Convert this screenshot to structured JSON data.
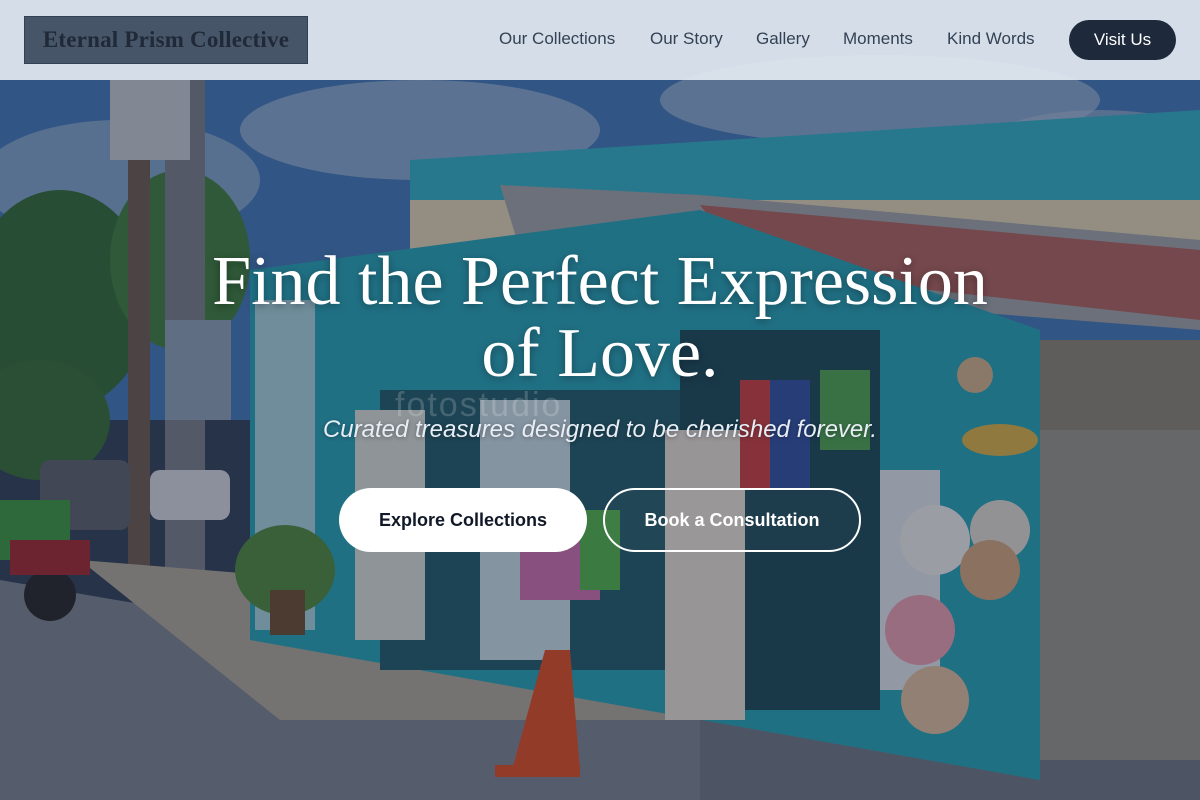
{
  "header": {
    "logo_text": "Eternal Prism Collective",
    "nav": [
      {
        "label": "Our Collections"
      },
      {
        "label": "Our Story"
      },
      {
        "label": "Gallery"
      },
      {
        "label": "Moments"
      },
      {
        "label": "Kind Words"
      }
    ],
    "cta_label": "Visit Us"
  },
  "hero": {
    "headline_line1": "Find the Perfect Expression",
    "headline_line2": "of Love.",
    "subtitle": "Curated treasures designed to be cherished forever.",
    "primary_button": "Explore Collections",
    "secondary_button": "Book a Consultation",
    "background_image": "market-stall-photo",
    "watermark": "fotostudio"
  },
  "colors": {
    "header_bg": "#e2e8f0",
    "logo_bg": "#475569",
    "nav_text": "#334155",
    "cta_bg": "#1e293b",
    "hero_text": "#ffffff"
  }
}
